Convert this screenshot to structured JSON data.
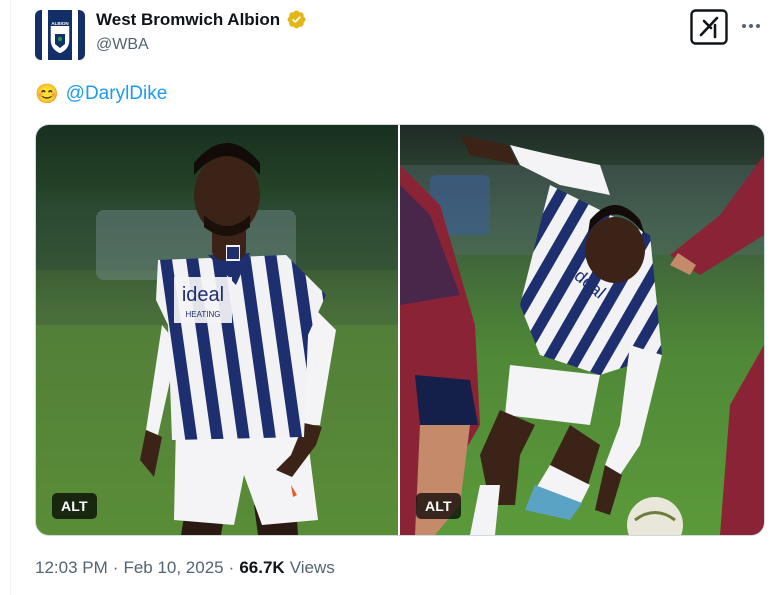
{
  "author": {
    "display_name": "West Bromwich Albion",
    "handle": "@WBA",
    "avatar_text": "ALBION",
    "verified_color": "#e2b719"
  },
  "post": {
    "emoji": "😊",
    "mention": "@DarylDike",
    "mention_color": "#1d9bf0"
  },
  "media": {
    "photos": [
      {
        "alt_label": "ALT",
        "shirt_text": "ideal",
        "shirt_sub": "HEATING"
      },
      {
        "alt_label": "ALT",
        "shirt_text": "ideal"
      }
    ]
  },
  "meta": {
    "time": "12:03 PM",
    "separator": "·",
    "date": "Feb 10, 2025",
    "views_count": "66.7K",
    "views_label": "Views"
  },
  "icons": {
    "verified": "verified-badge-icon",
    "grok": "grok-icon",
    "more": "more-dots-icon"
  }
}
